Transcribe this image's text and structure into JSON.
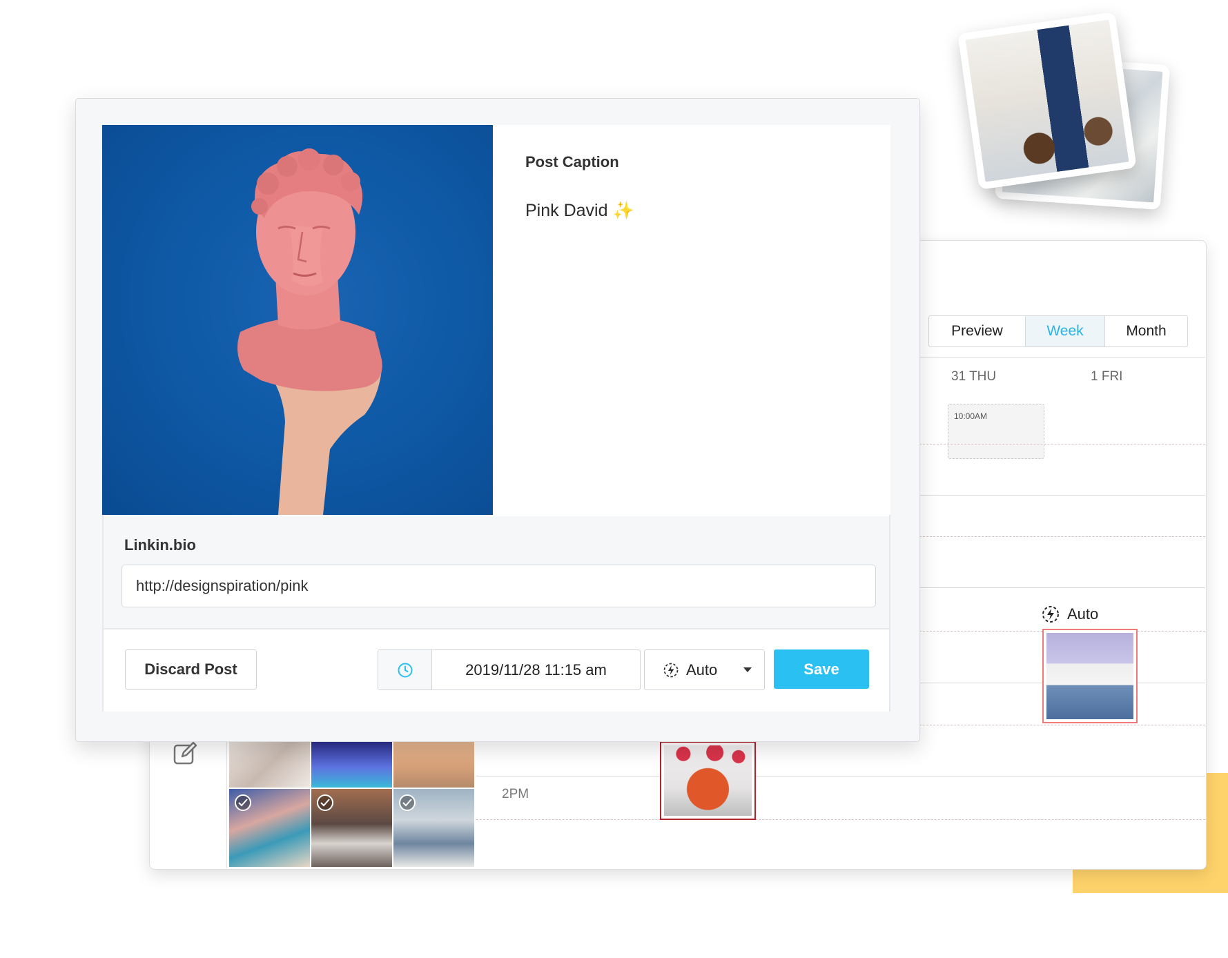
{
  "calendar": {
    "view_tabs": [
      {
        "label": "Preview",
        "active": false
      },
      {
        "label": "Week",
        "active": true
      },
      {
        "label": "Month",
        "active": false
      }
    ],
    "days": [
      "31 THU",
      "1 FRI"
    ],
    "empty_slot_time": "10:00AM",
    "auto_label": "Auto",
    "time_label": "2PM"
  },
  "post_editor": {
    "caption_label": "Post Caption",
    "caption_text": "Pink David ✨",
    "bio_label": "Linkin.bio",
    "bio_url": "http://designspiration/pink",
    "discard_label": "Discard Post",
    "datetime": "2019/11/28 11:15 am",
    "publish_mode": "Auto",
    "save_label": "Save"
  },
  "colors": {
    "accent": "#2ac0f2",
    "photo_background": "#0f5aa7",
    "statue": "#ec8a8c",
    "yellow": "#ffd36b"
  },
  "icons": [
    "clock-icon",
    "auto-publish-icon",
    "edit-icon",
    "check-icon",
    "caret-down-icon"
  ]
}
